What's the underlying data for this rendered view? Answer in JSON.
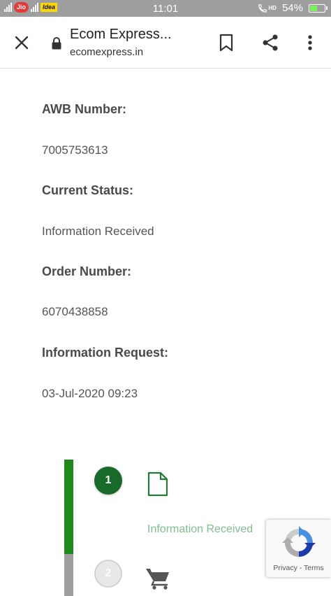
{
  "status_bar": {
    "carrier_1": "Jio",
    "carrier_2": "Idea",
    "time": "11:01",
    "network": "HD",
    "battery": "54%",
    "battery_level": 0.54,
    "battery_color": "#7cf05a"
  },
  "browser": {
    "title": "Ecom Express...",
    "url": "ecomexpress.in",
    "icons": [
      "close-icon",
      "lock-icon",
      "bookmark-icon",
      "share-icon",
      "more-vert-icon"
    ]
  },
  "details": {
    "awb_label": "AWB Number:",
    "awb_value": "7005753613",
    "status_label": "Current Status:",
    "status_value": "Information Received",
    "order_label": "Order Number:",
    "order_value": "6070438858",
    "request_label": "Information Request:",
    "request_value": "03-Jul-2020 09:23"
  },
  "timeline": {
    "active_color": "#1e8a1e",
    "inactive_color": "#9e9e9e",
    "steps": [
      {
        "number": "1",
        "icon": "document-icon",
        "label": "Information Received",
        "state": "done"
      },
      {
        "number": "2",
        "icon": "cart-icon",
        "state": "pending"
      }
    ]
  },
  "recaptcha": {
    "privacy": "Privacy",
    "separator": " - ",
    "terms": "Terms"
  }
}
